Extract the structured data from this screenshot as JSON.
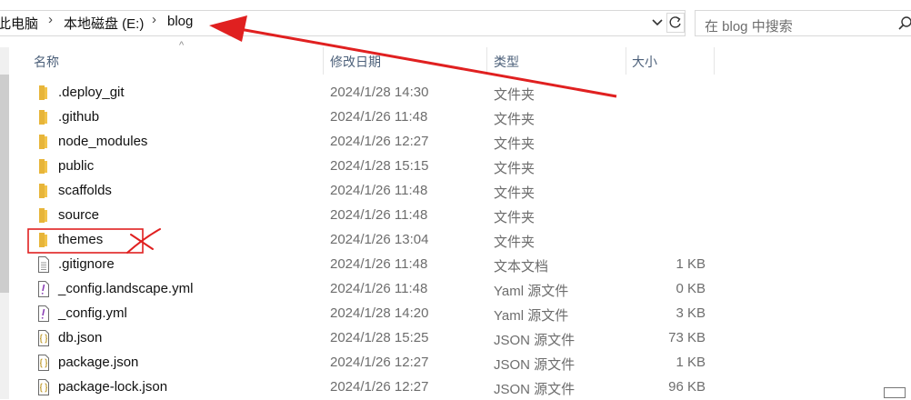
{
  "breadcrumb": {
    "items": [
      "此电脑",
      "本地磁盘 (E:)",
      "blog"
    ],
    "separator": "›"
  },
  "search": {
    "placeholder": "在 blog 中搜索"
  },
  "columns": {
    "name": "名称",
    "date": "修改日期",
    "type": "类型",
    "size": "大小"
  },
  "files": [
    {
      "name": ".deploy_git",
      "date": "2024/1/28 14:30",
      "type": "文件夹",
      "size": "",
      "icon": "folder-icon"
    },
    {
      "name": ".github",
      "date": "2024/1/26 11:48",
      "type": "文件夹",
      "size": "",
      "icon": "folder-icon"
    },
    {
      "name": "node_modules",
      "date": "2024/1/26 12:27",
      "type": "文件夹",
      "size": "",
      "icon": "folder-icon"
    },
    {
      "name": "public",
      "date": "2024/1/28 15:15",
      "type": "文件夹",
      "size": "",
      "icon": "folder-icon"
    },
    {
      "name": "scaffolds",
      "date": "2024/1/26 11:48",
      "type": "文件夹",
      "size": "",
      "icon": "folder-icon"
    },
    {
      "name": "source",
      "date": "2024/1/26 11:48",
      "type": "文件夹",
      "size": "",
      "icon": "folder-icon"
    },
    {
      "name": "themes",
      "date": "2024/1/26 13:04",
      "type": "文件夹",
      "size": "",
      "icon": "folder-icon"
    },
    {
      "name": ".gitignore",
      "date": "2024/1/26 11:48",
      "type": "文本文档",
      "size": "1 KB",
      "icon": "text-file-icon"
    },
    {
      "name": "_config.landscape.yml",
      "date": "2024/1/26 11:48",
      "type": "Yaml 源文件",
      "size": "0 KB",
      "icon": "yaml-file-icon"
    },
    {
      "name": "_config.yml",
      "date": "2024/1/28 14:20",
      "type": "Yaml 源文件",
      "size": "3 KB",
      "icon": "yaml-file-icon"
    },
    {
      "name": "db.json",
      "date": "2024/1/28 15:25",
      "type": "JSON 源文件",
      "size": "73 KB",
      "icon": "json-file-icon"
    },
    {
      "name": "package.json",
      "date": "2024/1/26 12:27",
      "type": "JSON 源文件",
      "size": "1 KB",
      "icon": "json-file-icon"
    },
    {
      "name": "package-lock.json",
      "date": "2024/1/26 12:27",
      "type": "JSON 源文件",
      "size": "96 KB",
      "icon": "json-file-icon"
    }
  ],
  "colors": {
    "annotation_red": "#e02020",
    "folder_yellow": "#f2c44b",
    "header_text": "#4c607a"
  }
}
